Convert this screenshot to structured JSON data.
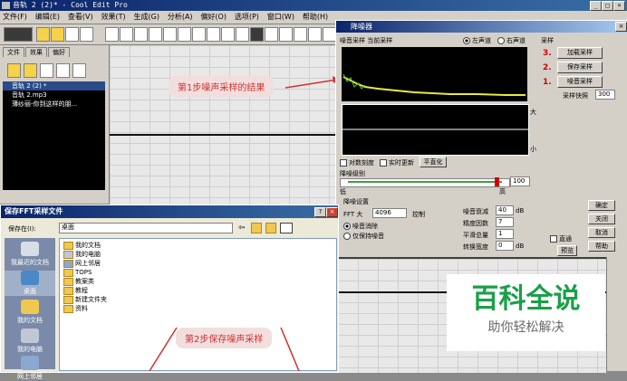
{
  "main_window": {
    "title": "音轨  2 (2)* - Cool Edit Pro",
    "menu": [
      "文件(F)",
      "编辑(E)",
      "查看(V)",
      "效果(T)",
      "生成(G)",
      "分析(A)",
      "偏好(O)",
      "选项(P)",
      "窗口(W)",
      "帮助(H)"
    ],
    "left_tabs": [
      "文件",
      "效果",
      "偏好"
    ],
    "files": [
      "音轨 2 (2) *",
      "音轨 2.mp3",
      "薄纱丽-你到这样的朋..."
    ]
  },
  "annotations": {
    "step1": "第1步噪声采样的结果",
    "step2": "第2步保存噪声采样"
  },
  "noise_dialog": {
    "title": "降噪器",
    "profile_label": "噪音采样 当前采样",
    "left_channel": "左声道",
    "right_channel": "右声道",
    "high_label": "大",
    "low_label": "小",
    "log_scale": "对数刻度",
    "live_update": "实时更新",
    "flatten": "平直化",
    "level_label": "降噪级别",
    "level_low": "低",
    "level_high": "高",
    "level_value": "100",
    "sampling_group": "采样",
    "step3_num": "3.",
    "step2_num": "2.",
    "step1_num": "1.",
    "load_sample": "加载采样",
    "save_sample": "保存采样",
    "get_sample": "噪音采样",
    "snapshots_label": "采样快照",
    "snapshots_value": "300",
    "settings_group": "降噪设置",
    "fft_label": "FFT 大",
    "fft_value": "4096",
    "control": "控制",
    "remove_noise": "噪音消除",
    "keep_noise": "仅保持噪音",
    "attenuation_label": "噪音衰减",
    "attenuation_value": "40",
    "attenuation_unit": "dB",
    "precision_label": "精度因数",
    "precision_value": "7",
    "smoothing_label": "平滑总量",
    "smoothing_value": "1",
    "transition_label": "转换宽度",
    "transition_value": "0",
    "transition_unit": "dB",
    "bypass": "直通",
    "ok": "确定",
    "close": "关闭",
    "cancel": "取消",
    "preview": "预览",
    "help": "帮助"
  },
  "save_dialog": {
    "title": "保存FFT采样文件",
    "save_in_label": "保存在(I):",
    "save_in_value": "桌面",
    "places": [
      "我最近的文档",
      "桌面",
      "我的文档",
      "我的电脑",
      "网上邻居"
    ],
    "items": [
      "我的文档",
      "我的电脑",
      "网上邻居",
      "TOPS",
      "教案类",
      "教程",
      "新建文件夹",
      "资料"
    ]
  },
  "watermark": {
    "main": "百科全说",
    "sub": "助你轻松解决"
  },
  "colors": {
    "accent_red": "#d43030",
    "watermark_green": "#1aa048"
  }
}
